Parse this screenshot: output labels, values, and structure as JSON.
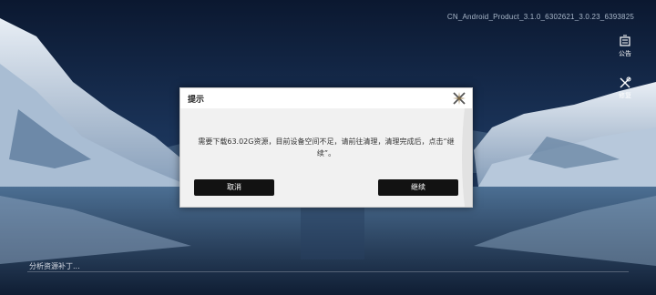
{
  "version": "CN_Android_Product_3.1.0_6302621_3.0.23_6393825",
  "side_buttons": {
    "notice_label": "公告",
    "repair_label": "修复"
  },
  "dialog": {
    "title": "提示",
    "message": "需要下载63.02G资源，目前设备空间不足，请前往清理，清理完成后，点击“继续”。",
    "cancel_label": "取消",
    "continue_label": "继续"
  },
  "status": {
    "text": "分析资源补丁...",
    "progress": 0
  },
  "colors": {
    "button_bg": "#121212",
    "dialog_bg": "#f1f1f1",
    "sky": "#0d1b33"
  }
}
